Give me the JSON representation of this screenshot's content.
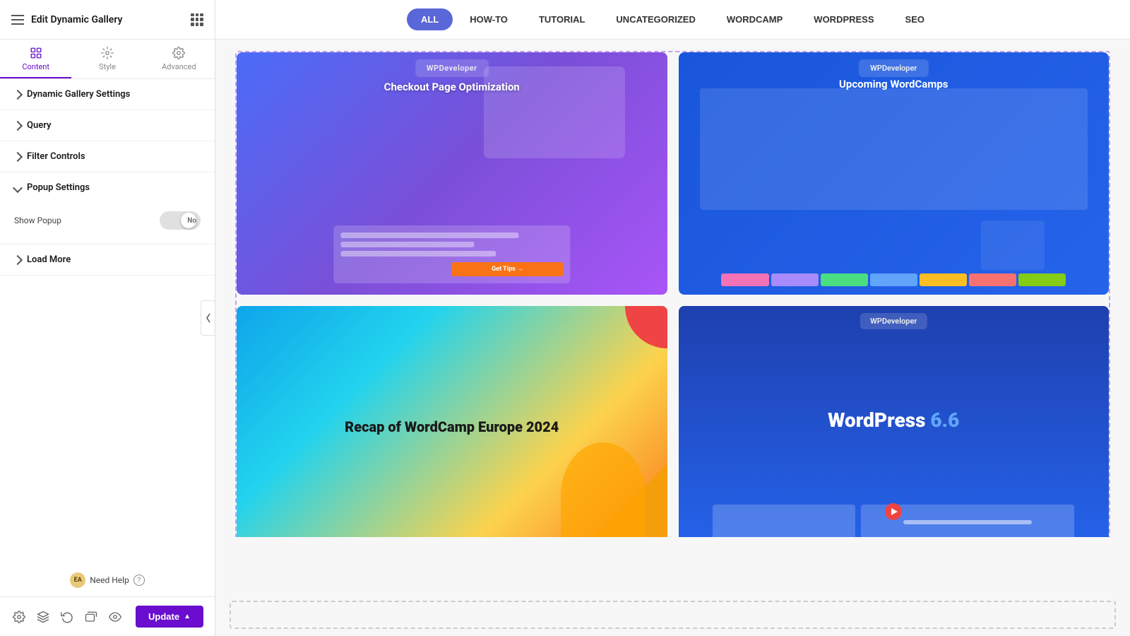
{
  "header": {
    "title": "Edit Dynamic Gallery",
    "hamburger_label": "menu",
    "grid_label": "apps"
  },
  "tabs": [
    {
      "id": "content",
      "label": "Content",
      "icon": "content-icon",
      "active": true
    },
    {
      "id": "style",
      "label": "Style",
      "icon": "style-icon",
      "active": false
    },
    {
      "id": "advanced",
      "label": "Advanced",
      "icon": "advanced-icon",
      "active": false
    }
  ],
  "accordion": [
    {
      "id": "dynamic-gallery-settings",
      "label": "Dynamic Gallery Settings",
      "open": false
    },
    {
      "id": "query",
      "label": "Query",
      "open": false
    },
    {
      "id": "filter-controls",
      "label": "Filter Controls",
      "open": false
    },
    {
      "id": "popup-settings",
      "label": "Popup Settings",
      "open": true,
      "fields": [
        {
          "id": "show-popup",
          "label": "Show Popup",
          "type": "toggle",
          "value": false,
          "value_label": "No"
        }
      ]
    },
    {
      "id": "load-more",
      "label": "Load More",
      "open": false
    }
  ],
  "need_help": {
    "avatar_initials": "EA",
    "label": "Need Help",
    "question_mark": "?"
  },
  "bottom_bar": {
    "icons": [
      "settings-icon",
      "layers-icon",
      "history-icon",
      "responsive-icon",
      "eye-icon"
    ],
    "update_label": "Update"
  },
  "filter_tabs": [
    {
      "id": "all",
      "label": "ALL",
      "active": true
    },
    {
      "id": "how-to",
      "label": "HOW-TO",
      "active": false
    },
    {
      "id": "tutorial",
      "label": "TUTORIAL",
      "active": false
    },
    {
      "id": "uncategorized",
      "label": "UNCATEGORIZED",
      "active": false
    },
    {
      "id": "wordcamp",
      "label": "WORDCAMP",
      "active": false
    },
    {
      "id": "wordpress",
      "label": "WORDPRESS",
      "active": false
    },
    {
      "id": "seo",
      "label": "SEO",
      "active": false
    }
  ],
  "gallery_items": [
    {
      "id": "checkout",
      "title": "Checkout Page Optimization",
      "bg_type": "checkout",
      "brand": "WPDeveloper"
    },
    {
      "id": "wordcamps",
      "title": "Upcoming WordCamps",
      "bg_type": "wordcamps",
      "brand": "WPDeveloper"
    },
    {
      "id": "europe",
      "title": "Recap of WordCamp Europe 2024",
      "bg_type": "europe",
      "brand": "WPDeveloper"
    },
    {
      "id": "wordpress66",
      "title": "WordPress 6.6",
      "bg_type": "wordpress66",
      "brand": "WPDeveloper"
    }
  ]
}
